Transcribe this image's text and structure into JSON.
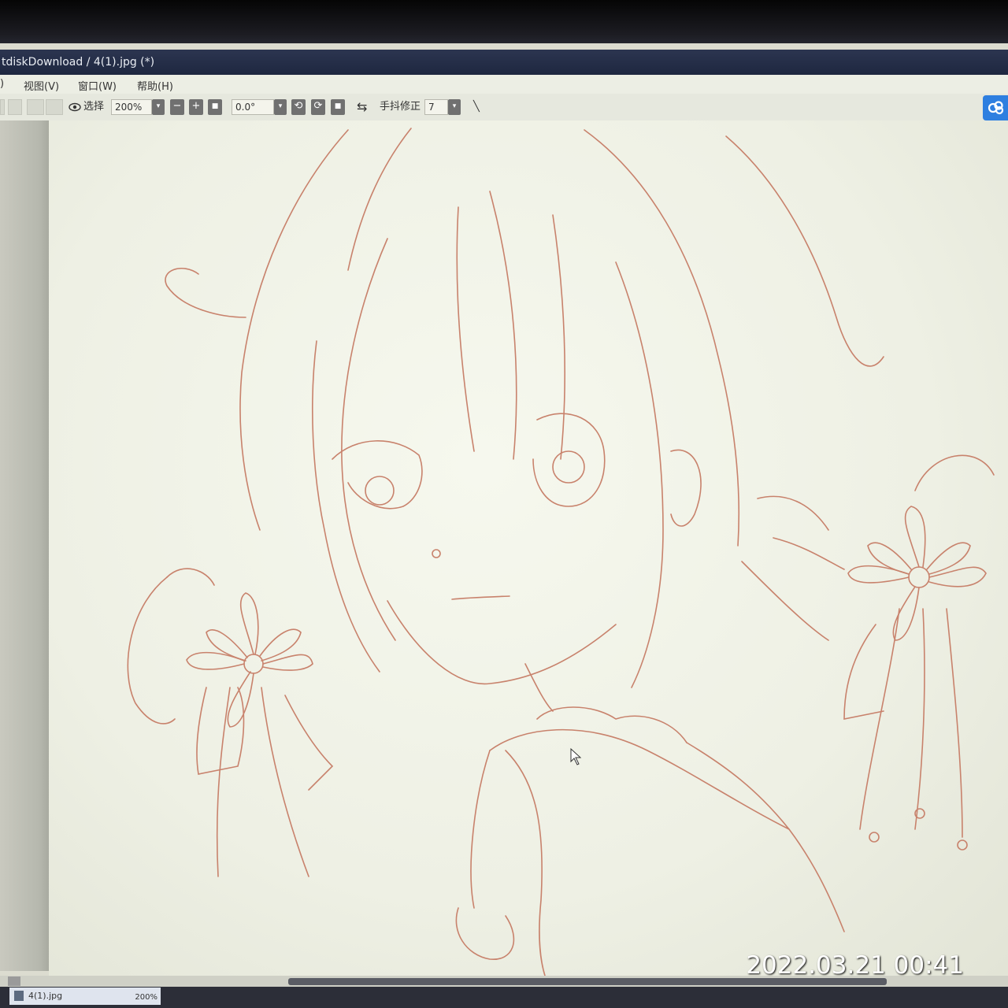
{
  "window": {
    "title": "tdiskDownload / 4(1).jpg (*)"
  },
  "menu": {
    "partial": ")",
    "view": "视图(V)",
    "window": "窗口(W)",
    "help": "帮助(H)"
  },
  "toolbar": {
    "select_label": "选择",
    "zoom_value": "200%",
    "minus": "−",
    "plus": "+",
    "stop": "■",
    "angle_value": "0.0°",
    "flip_icon": "⇆",
    "stabilizer_label": "手抖修正",
    "stabilizer_value": "7",
    "pen_icon": "╲"
  },
  "icons": [
    "eye-icon",
    "zoom-dropdown-icon",
    "zoom-out-icon",
    "zoom-in-icon",
    "zoom-reset-icon",
    "angle-dropdown-icon",
    "rotate-left-icon",
    "rotate-right-icon",
    "rotate-reset-icon",
    "flip-icon",
    "stabilizer-dropdown-icon",
    "pen-icon",
    "cloud-sync-icon",
    "file-icon"
  ],
  "colors": {
    "titlebar": "#2c3550",
    "sketch_stroke": "#c8826c",
    "canvas": "#f2f4ea",
    "cloud": "#2e7fe0"
  },
  "statusbar": {
    "file_tab": "4(1).jpg",
    "zoom": "200%"
  },
  "photo_timestamp": "2022.03.21 00:41"
}
